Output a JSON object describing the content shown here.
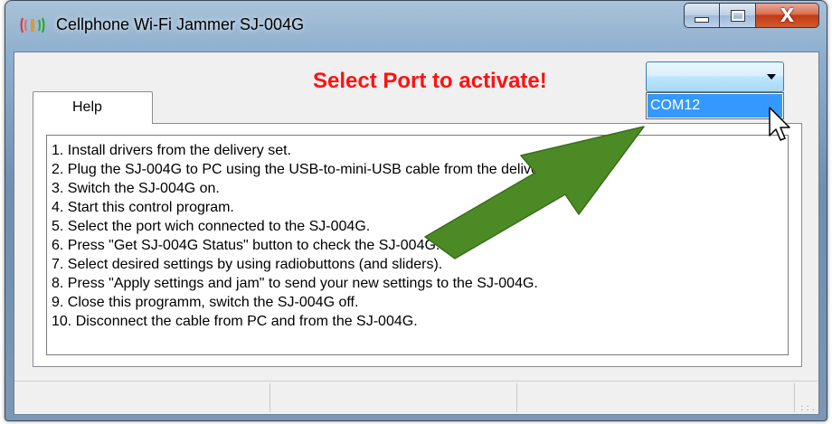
{
  "window": {
    "title": "Cellphone Wi-Fi Jammer SJ-004G",
    "close_glyph": "X",
    "icon": "signal-waves-icon"
  },
  "banner": {
    "text": "Select Port to activate!",
    "color": "#ff1111"
  },
  "port_select": {
    "value": "",
    "options": [
      "COM12"
    ],
    "highlighted": "COM12"
  },
  "tabs": [
    {
      "label": "Help"
    }
  ],
  "help": {
    "lines": [
      "1. Install drivers from the delivery set.",
      "2. Plug the SJ-004G to PC using the USB-to-mini-USB cable from the delivery set.",
      "3. Switch  the SJ-004G on.",
      "4. Start this control program.",
      "5. Select the port wich connected to the SJ-004G.",
      "6. Press \"Get SJ-004G Status\" button to check the SJ-004G.",
      "7. Select desired settings by using radiobuttons (and sliders).",
      "8. Press \"Apply settings and jam\" to send your new settings to the SJ-004G.",
      "9. Close this programm, switch the SJ-004G off.",
      "10. Disconnect the cable from PC and from the SJ-004G."
    ]
  },
  "annotation": {
    "arrow_color": "#4c8a25",
    "icon": "green-arrow-icon"
  },
  "status_bar": {
    "panels": [
      "",
      "",
      ""
    ]
  }
}
